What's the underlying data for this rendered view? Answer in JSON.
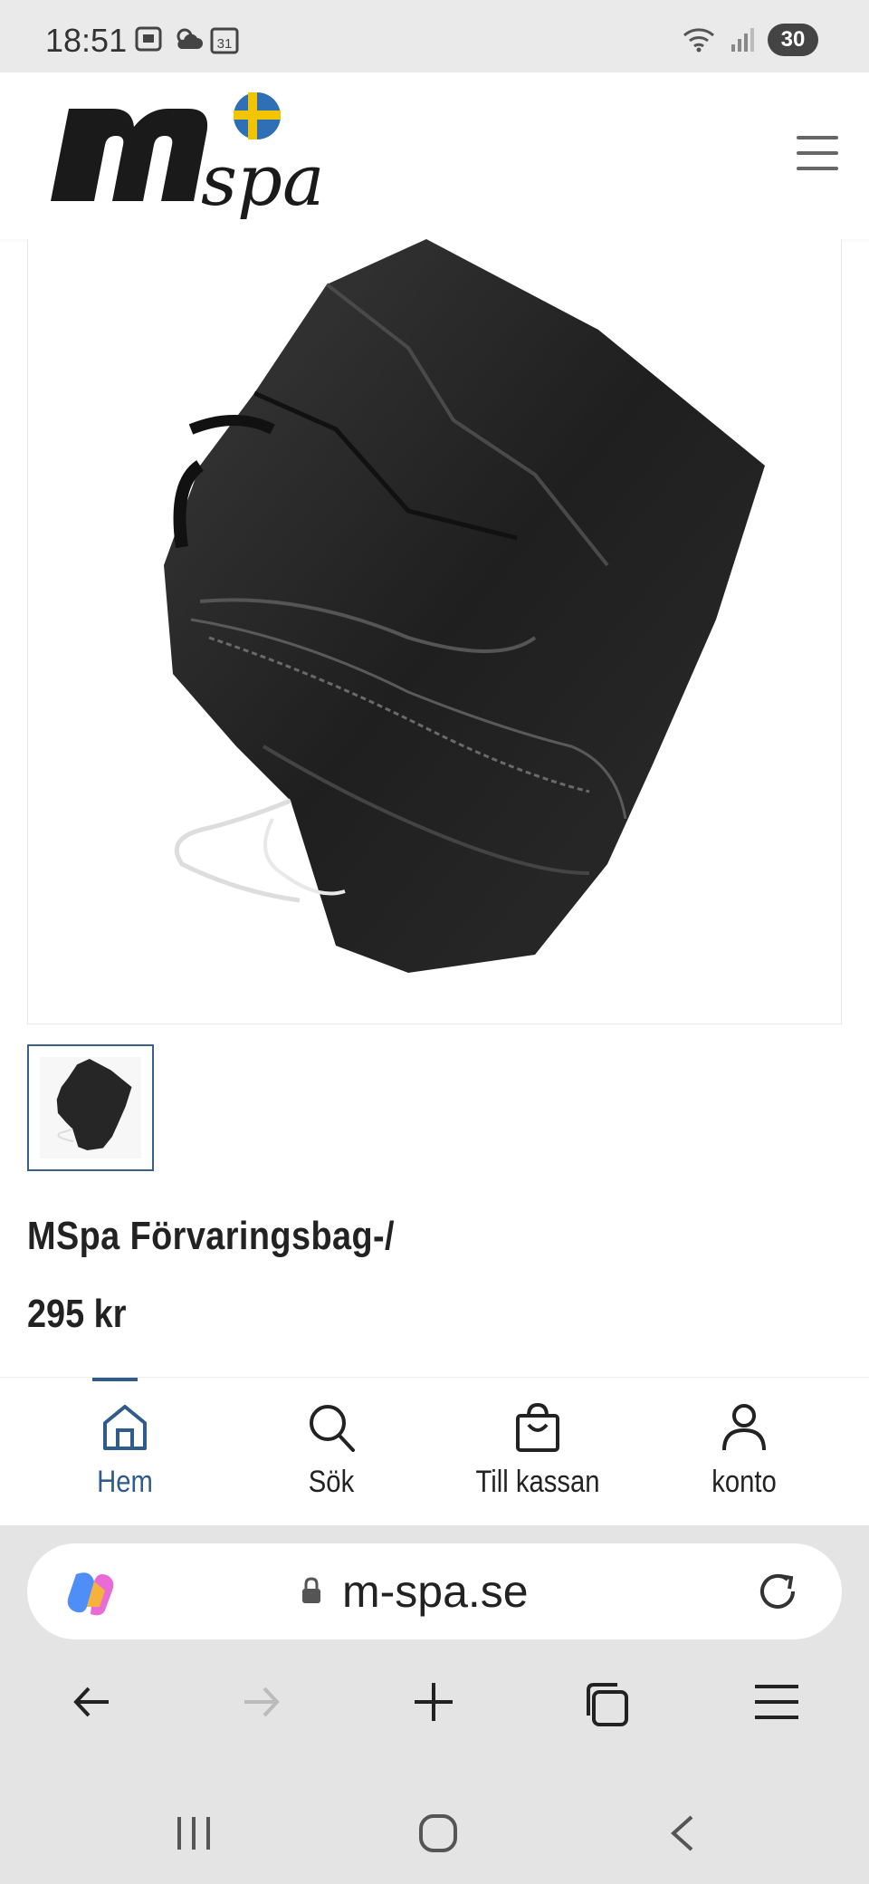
{
  "status_bar": {
    "time": "18:51",
    "calendar_day": "31",
    "battery": "30",
    "icons": [
      "screenshot-icon",
      "weather-icon",
      "calendar-icon",
      "wifi-icon",
      "signal-icon",
      "battery-icon"
    ]
  },
  "header": {
    "logo_text": "spa",
    "logo_letter": "m",
    "menu_icon": "hamburger-menu-icon"
  },
  "product": {
    "title": "MSpa Förvaringsbag-/",
    "price": "295 kr"
  },
  "bottom_nav": {
    "items": [
      {
        "label": "Hem",
        "icon": "home-icon",
        "active": true
      },
      {
        "label": "Sök",
        "icon": "search-icon",
        "active": false
      },
      {
        "label": "Till kassan",
        "icon": "bag-icon",
        "active": false
      },
      {
        "label": "konto",
        "icon": "user-icon",
        "active": false
      }
    ]
  },
  "browser": {
    "url": "m-spa.se",
    "tools": [
      "back-icon",
      "forward-icon",
      "new-tab-icon",
      "tabs-icon",
      "menu-icon"
    ]
  },
  "colors": {
    "accent": "#2f5c8a",
    "status_bar_bg": "#eaeaea",
    "browser_bg": "#e4e4e4"
  }
}
